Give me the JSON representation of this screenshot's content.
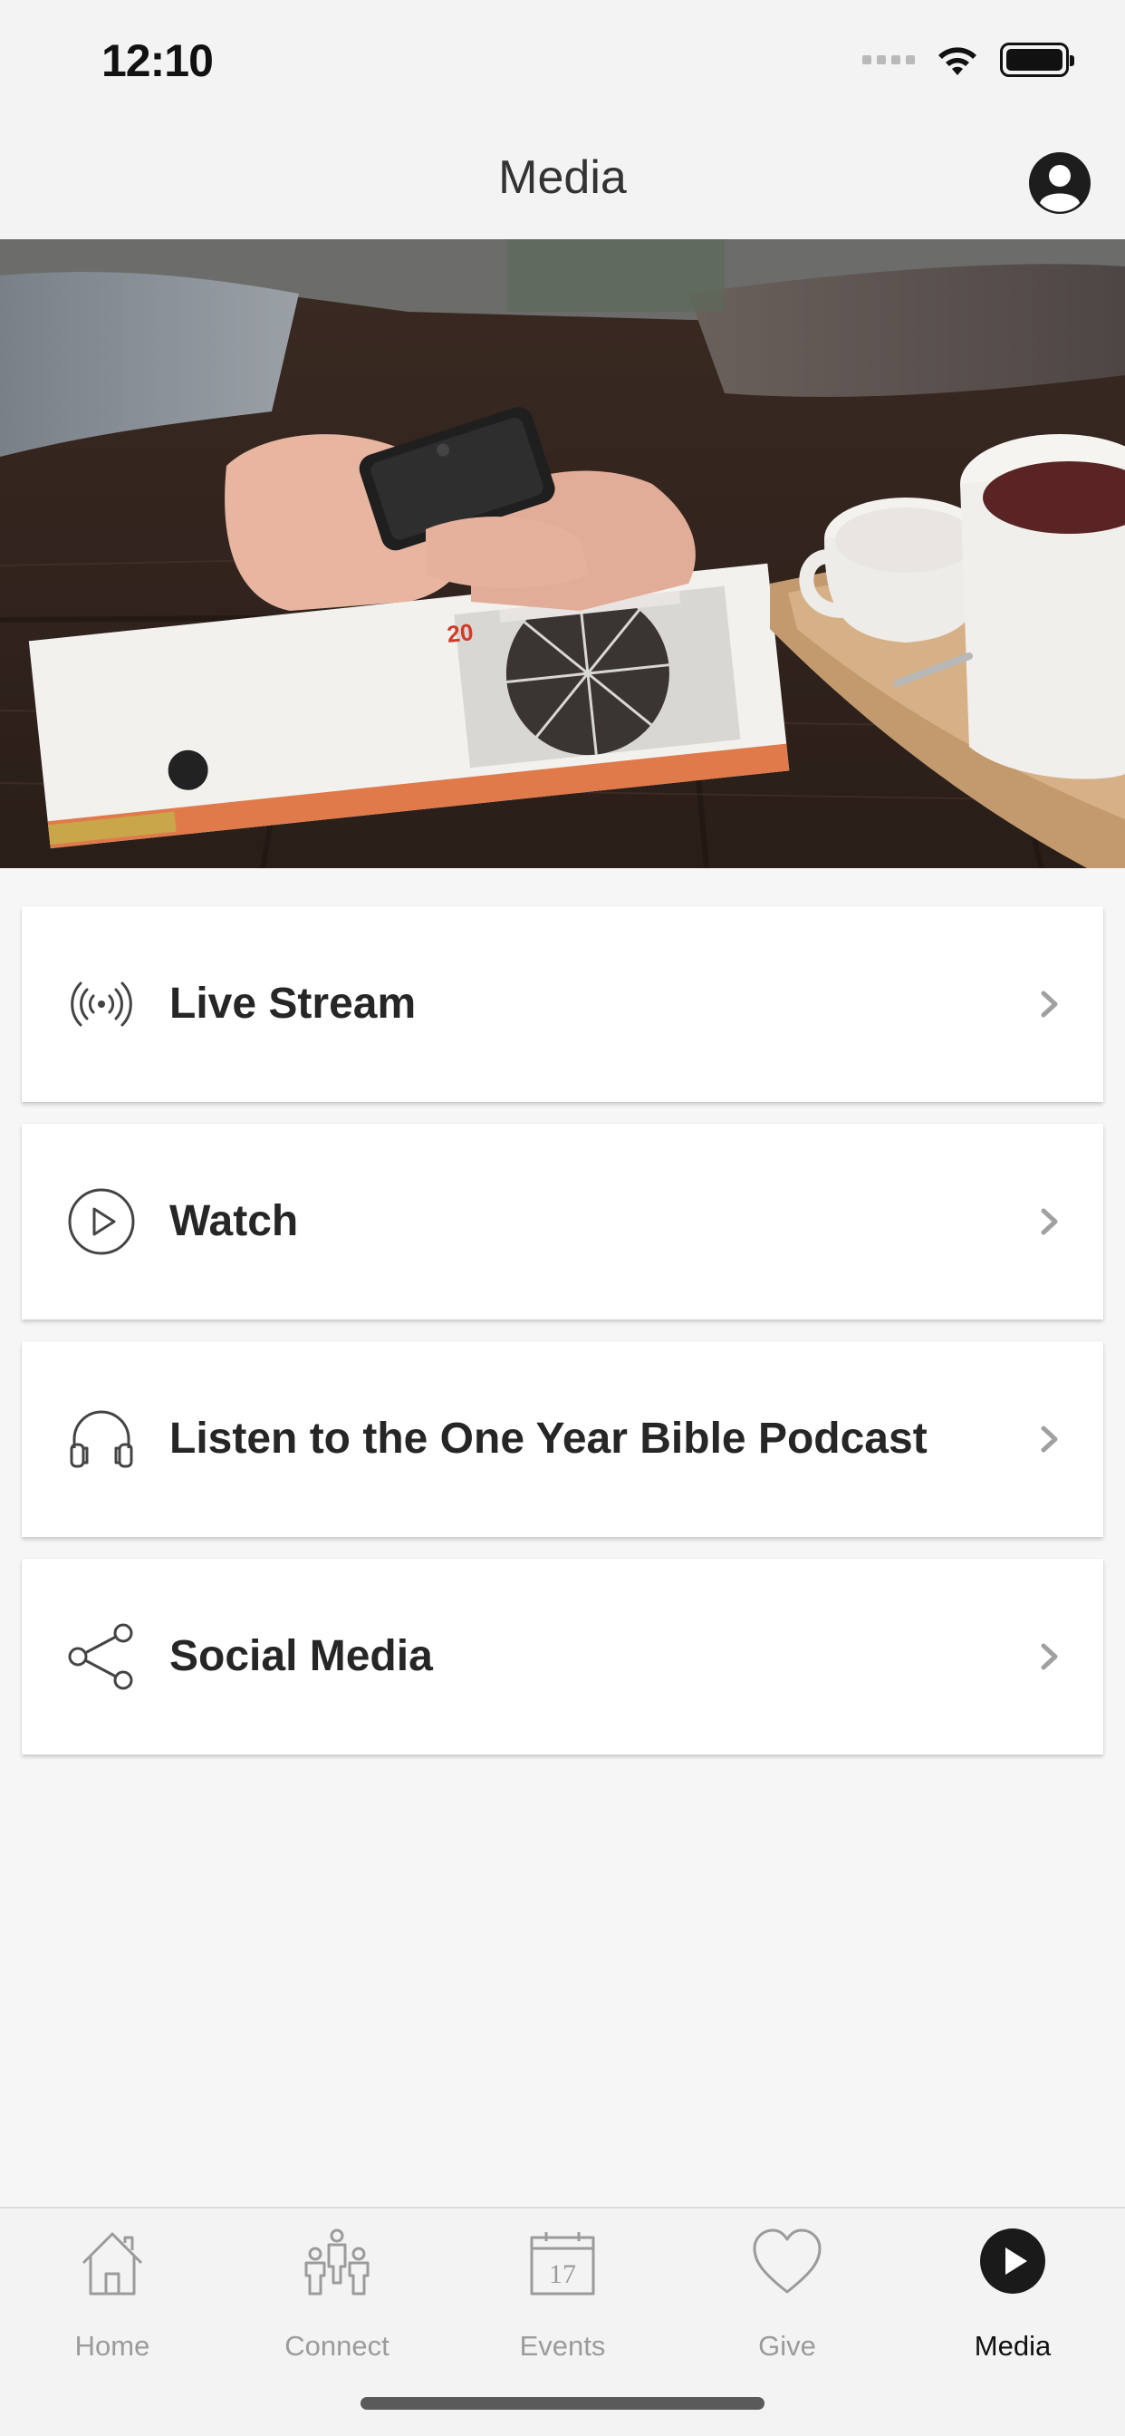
{
  "status_bar": {
    "time": "12:10"
  },
  "header": {
    "title": "Media",
    "profile_icon": "user-circle-icon"
  },
  "hero": {
    "description_icon": "hero-photo"
  },
  "menu": {
    "items": [
      {
        "label": "Live Stream",
        "icon": "broadcast-icon"
      },
      {
        "label": "Watch",
        "icon": "play-circle-icon"
      },
      {
        "label": "Listen to the One Year Bible Podcast",
        "icon": "headphones-icon"
      },
      {
        "label": "Social Media",
        "icon": "share-icon"
      }
    ]
  },
  "tab_bar": {
    "tabs": [
      {
        "label": "Home",
        "icon": "home-icon",
        "active": false
      },
      {
        "label": "Connect",
        "icon": "people-icon",
        "active": false
      },
      {
        "label": "Events",
        "icon": "calendar-icon",
        "active": false,
        "calendar_day": "17"
      },
      {
        "label": "Give",
        "icon": "heart-icon",
        "active": false
      },
      {
        "label": "Media",
        "icon": "play-circle-filled-icon",
        "active": true
      }
    ]
  },
  "colors": {
    "background": "#f6f6f6",
    "bar": "#f3f3f3",
    "active": "#111111",
    "inactive": "#9b9b9b"
  }
}
